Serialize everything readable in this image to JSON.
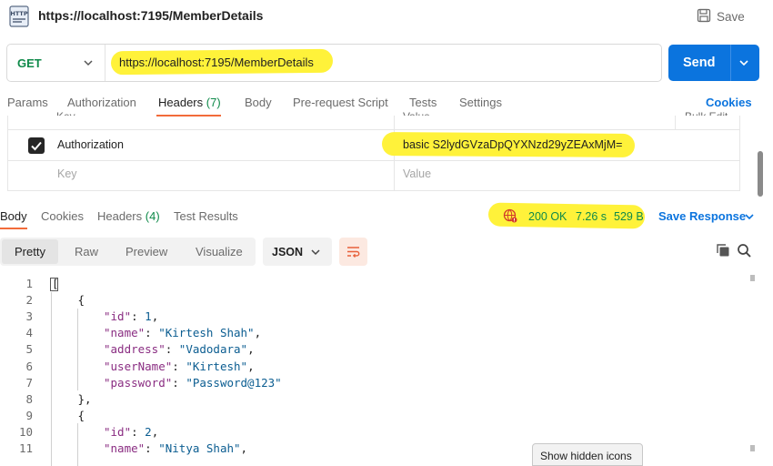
{
  "request": {
    "title": "https://localhost:7195/MemberDetails",
    "save_label": "Save",
    "method": "GET",
    "url": "https://localhost:7195/MemberDetails",
    "send_label": "Send"
  },
  "request_tabs": [
    {
      "label": "Params"
    },
    {
      "label": "Authorization"
    },
    {
      "label": "Headers",
      "count": "(7)",
      "active": true
    },
    {
      "label": "Body"
    },
    {
      "label": "Pre-request Script"
    },
    {
      "label": "Tests"
    },
    {
      "label": "Settings"
    }
  ],
  "cookies_label": "Cookies",
  "headers_table": {
    "col_key": "Key",
    "col_value": "Value",
    "col_bulk": "Bulk Edit",
    "rows": [
      {
        "checked": true,
        "key": "Authorization",
        "value": "basic S2lydGVzaDpQYXNzd29yZEAxMjM="
      }
    ],
    "placeholder_key": "Key",
    "placeholder_value": "Value"
  },
  "response_tabs": [
    {
      "label": "Body",
      "active": true
    },
    {
      "label": "Cookies"
    },
    {
      "label": "Headers",
      "count": "(4)"
    },
    {
      "label": "Test Results"
    }
  ],
  "response_status": {
    "status": "200 OK",
    "time": "7.26 s",
    "size": "529 B",
    "save_response_label": "Save Response"
  },
  "format_toolbar": {
    "modes": [
      "Pretty",
      "Raw",
      "Preview",
      "Visualize"
    ],
    "active_mode": "Pretty",
    "language": "JSON"
  },
  "code_lines": [
    {
      "n": "1",
      "indent": 0,
      "tokens": [
        {
          "t": "[",
          "c": "p"
        }
      ]
    },
    {
      "n": "2",
      "indent": 1,
      "tokens": [
        {
          "t": "{",
          "c": "p"
        }
      ]
    },
    {
      "n": "3",
      "indent": 2,
      "tokens": [
        {
          "t": "\"id\"",
          "c": "k"
        },
        {
          "t": ": ",
          "c": "p"
        },
        {
          "t": "1",
          "c": "n"
        },
        {
          "t": ",",
          "c": "p"
        }
      ]
    },
    {
      "n": "4",
      "indent": 2,
      "tokens": [
        {
          "t": "\"name\"",
          "c": "k"
        },
        {
          "t": ": ",
          "c": "p"
        },
        {
          "t": "\"Kirtesh Shah\"",
          "c": "s"
        },
        {
          "t": ",",
          "c": "p"
        }
      ]
    },
    {
      "n": "5",
      "indent": 2,
      "tokens": [
        {
          "t": "\"address\"",
          "c": "k"
        },
        {
          "t": ": ",
          "c": "p"
        },
        {
          "t": "\"Vadodara\"",
          "c": "s"
        },
        {
          "t": ",",
          "c": "p"
        }
      ]
    },
    {
      "n": "6",
      "indent": 2,
      "tokens": [
        {
          "t": "\"userName\"",
          "c": "k"
        },
        {
          "t": ": ",
          "c": "p"
        },
        {
          "t": "\"Kirtesh\"",
          "c": "s"
        },
        {
          "t": ",",
          "c": "p"
        }
      ]
    },
    {
      "n": "7",
      "indent": 2,
      "tokens": [
        {
          "t": "\"password\"",
          "c": "k"
        },
        {
          "t": ": ",
          "c": "p"
        },
        {
          "t": "\"Password@123\"",
          "c": "s"
        }
      ]
    },
    {
      "n": "8",
      "indent": 1,
      "tokens": [
        {
          "t": "},",
          "c": "p"
        }
      ]
    },
    {
      "n": "9",
      "indent": 1,
      "tokens": [
        {
          "t": "{",
          "c": "p"
        }
      ]
    },
    {
      "n": "10",
      "indent": 2,
      "tokens": [
        {
          "t": "\"id\"",
          "c": "k"
        },
        {
          "t": ": ",
          "c": "p"
        },
        {
          "t": "2",
          "c": "n"
        },
        {
          "t": ",",
          "c": "p"
        }
      ]
    },
    {
      "n": "11",
      "indent": 2,
      "tokens": [
        {
          "t": "\"name\"",
          "c": "k"
        },
        {
          "t": ": ",
          "c": "p"
        },
        {
          "t": "\"Nitya Shah\"",
          "c": "s"
        },
        {
          "t": ",",
          "c": "p"
        }
      ]
    }
  ],
  "tooltip": "Show hidden icons",
  "colors": {
    "accent_blue": "#0b74de",
    "status_green": "#0f8a4a",
    "active_tab_underline": "#f26b3a",
    "highlighter": "#fff23a",
    "json_key": "#8a2d82",
    "json_value": "#0b5d91"
  },
  "icons": {
    "request_type": "http-icon",
    "save": "save-icon",
    "network": "globe-error-icon",
    "wrap": "wrap-lines-icon",
    "copy": "copy-icon",
    "search": "search-icon"
  }
}
